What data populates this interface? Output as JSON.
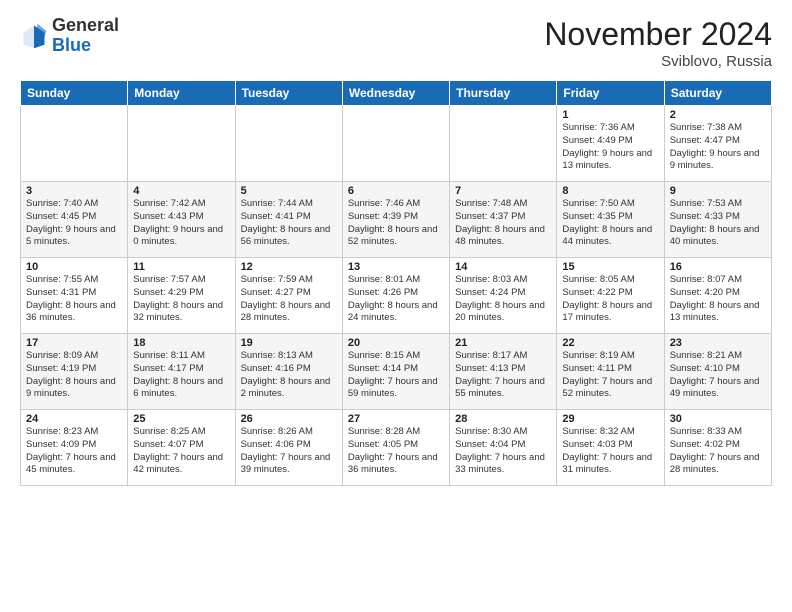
{
  "header": {
    "logo_general": "General",
    "logo_blue": "Blue",
    "month_title": "November 2024",
    "subtitle": "Sviblovo, Russia"
  },
  "weekdays": [
    "Sunday",
    "Monday",
    "Tuesday",
    "Wednesday",
    "Thursday",
    "Friday",
    "Saturday"
  ],
  "weeks": [
    [
      {
        "day": "",
        "info": ""
      },
      {
        "day": "",
        "info": ""
      },
      {
        "day": "",
        "info": ""
      },
      {
        "day": "",
        "info": ""
      },
      {
        "day": "",
        "info": ""
      },
      {
        "day": "1",
        "info": "Sunrise: 7:36 AM\nSunset: 4:49 PM\nDaylight: 9 hours and 13 minutes."
      },
      {
        "day": "2",
        "info": "Sunrise: 7:38 AM\nSunset: 4:47 PM\nDaylight: 9 hours and 9 minutes."
      }
    ],
    [
      {
        "day": "3",
        "info": "Sunrise: 7:40 AM\nSunset: 4:45 PM\nDaylight: 9 hours and 5 minutes."
      },
      {
        "day": "4",
        "info": "Sunrise: 7:42 AM\nSunset: 4:43 PM\nDaylight: 9 hours and 0 minutes."
      },
      {
        "day": "5",
        "info": "Sunrise: 7:44 AM\nSunset: 4:41 PM\nDaylight: 8 hours and 56 minutes."
      },
      {
        "day": "6",
        "info": "Sunrise: 7:46 AM\nSunset: 4:39 PM\nDaylight: 8 hours and 52 minutes."
      },
      {
        "day": "7",
        "info": "Sunrise: 7:48 AM\nSunset: 4:37 PM\nDaylight: 8 hours and 48 minutes."
      },
      {
        "day": "8",
        "info": "Sunrise: 7:50 AM\nSunset: 4:35 PM\nDaylight: 8 hours and 44 minutes."
      },
      {
        "day": "9",
        "info": "Sunrise: 7:53 AM\nSunset: 4:33 PM\nDaylight: 8 hours and 40 minutes."
      }
    ],
    [
      {
        "day": "10",
        "info": "Sunrise: 7:55 AM\nSunset: 4:31 PM\nDaylight: 8 hours and 36 minutes."
      },
      {
        "day": "11",
        "info": "Sunrise: 7:57 AM\nSunset: 4:29 PM\nDaylight: 8 hours and 32 minutes."
      },
      {
        "day": "12",
        "info": "Sunrise: 7:59 AM\nSunset: 4:27 PM\nDaylight: 8 hours and 28 minutes."
      },
      {
        "day": "13",
        "info": "Sunrise: 8:01 AM\nSunset: 4:26 PM\nDaylight: 8 hours and 24 minutes."
      },
      {
        "day": "14",
        "info": "Sunrise: 8:03 AM\nSunset: 4:24 PM\nDaylight: 8 hours and 20 minutes."
      },
      {
        "day": "15",
        "info": "Sunrise: 8:05 AM\nSunset: 4:22 PM\nDaylight: 8 hours and 17 minutes."
      },
      {
        "day": "16",
        "info": "Sunrise: 8:07 AM\nSunset: 4:20 PM\nDaylight: 8 hours and 13 minutes."
      }
    ],
    [
      {
        "day": "17",
        "info": "Sunrise: 8:09 AM\nSunset: 4:19 PM\nDaylight: 8 hours and 9 minutes."
      },
      {
        "day": "18",
        "info": "Sunrise: 8:11 AM\nSunset: 4:17 PM\nDaylight: 8 hours and 6 minutes."
      },
      {
        "day": "19",
        "info": "Sunrise: 8:13 AM\nSunset: 4:16 PM\nDaylight: 8 hours and 2 minutes."
      },
      {
        "day": "20",
        "info": "Sunrise: 8:15 AM\nSunset: 4:14 PM\nDaylight: 7 hours and 59 minutes."
      },
      {
        "day": "21",
        "info": "Sunrise: 8:17 AM\nSunset: 4:13 PM\nDaylight: 7 hours and 55 minutes."
      },
      {
        "day": "22",
        "info": "Sunrise: 8:19 AM\nSunset: 4:11 PM\nDaylight: 7 hours and 52 minutes."
      },
      {
        "day": "23",
        "info": "Sunrise: 8:21 AM\nSunset: 4:10 PM\nDaylight: 7 hours and 49 minutes."
      }
    ],
    [
      {
        "day": "24",
        "info": "Sunrise: 8:23 AM\nSunset: 4:09 PM\nDaylight: 7 hours and 45 minutes."
      },
      {
        "day": "25",
        "info": "Sunrise: 8:25 AM\nSunset: 4:07 PM\nDaylight: 7 hours and 42 minutes."
      },
      {
        "day": "26",
        "info": "Sunrise: 8:26 AM\nSunset: 4:06 PM\nDaylight: 7 hours and 39 minutes."
      },
      {
        "day": "27",
        "info": "Sunrise: 8:28 AM\nSunset: 4:05 PM\nDaylight: 7 hours and 36 minutes."
      },
      {
        "day": "28",
        "info": "Sunrise: 8:30 AM\nSunset: 4:04 PM\nDaylight: 7 hours and 33 minutes."
      },
      {
        "day": "29",
        "info": "Sunrise: 8:32 AM\nSunset: 4:03 PM\nDaylight: 7 hours and 31 minutes."
      },
      {
        "day": "30",
        "info": "Sunrise: 8:33 AM\nSunset: 4:02 PM\nDaylight: 7 hours and 28 minutes."
      }
    ]
  ]
}
